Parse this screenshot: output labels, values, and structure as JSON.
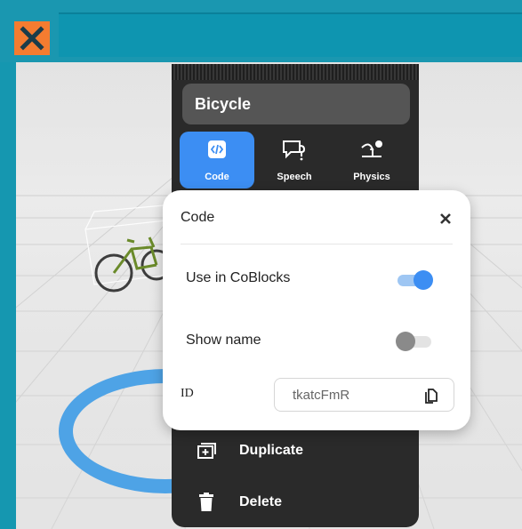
{
  "object": {
    "name": "Bicycle"
  },
  "tools": [
    {
      "label": "Code",
      "icon": "code-icon",
      "active": true
    },
    {
      "label": "Speech",
      "icon": "speech-bubble-icon",
      "active": false
    },
    {
      "label": "Physics",
      "icon": "physics-icon",
      "active": false
    }
  ],
  "popup": {
    "title": "Code",
    "use_in_coblocks_label": "Use in CoBlocks",
    "use_in_coblocks_on": true,
    "show_name_label": "Show name",
    "show_name_on": false,
    "id_label": "ID",
    "id_value": "tkatcFmR"
  },
  "menu": {
    "duplicate_label": "Duplicate",
    "delete_label": "Delete"
  },
  "colors": {
    "accent": "#3c8ef3",
    "header": "#1597b0",
    "close_box": "#f47c30",
    "menu_bg": "#2a2a2a"
  }
}
